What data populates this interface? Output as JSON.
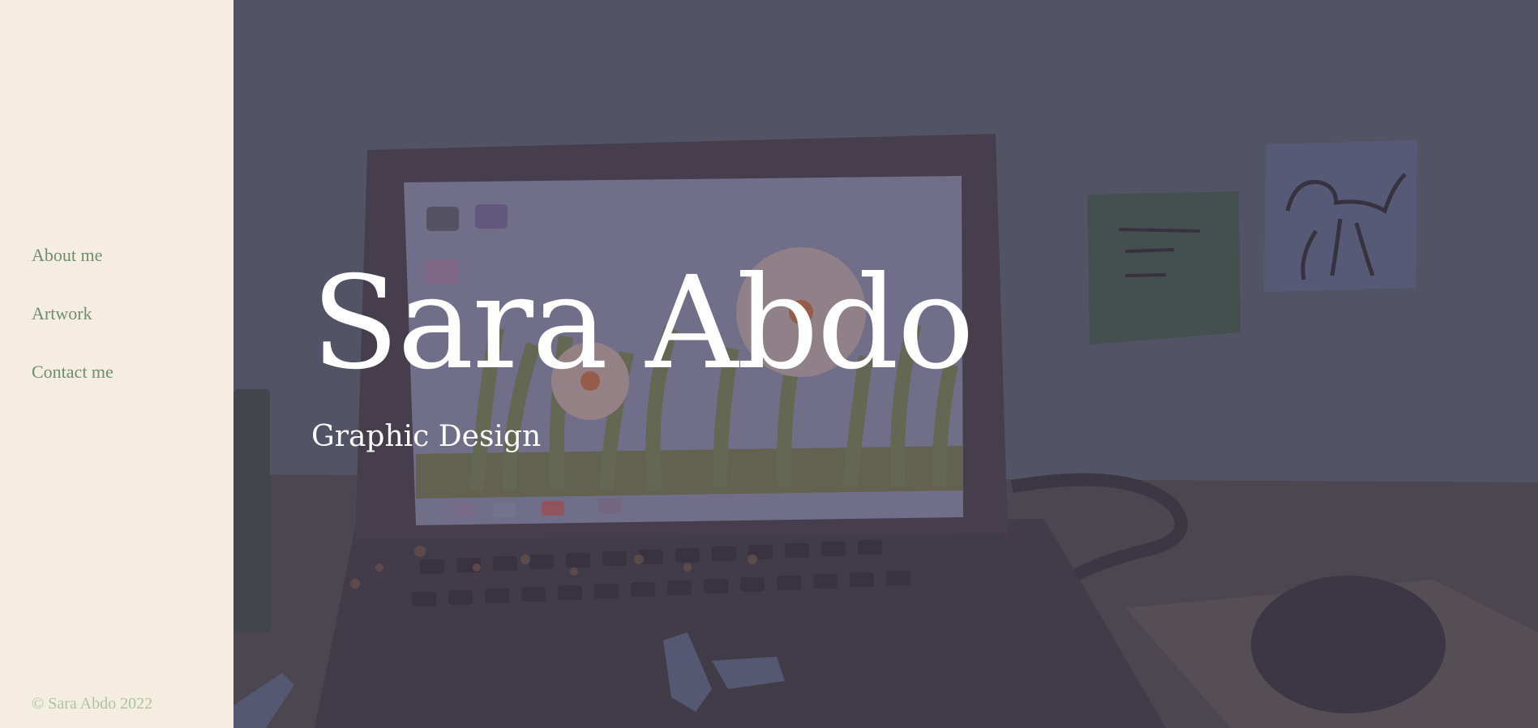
{
  "sidebar": {
    "nav": [
      {
        "label": "About me"
      },
      {
        "label": "Artwork"
      },
      {
        "label": "Contact me"
      }
    ],
    "copyright": "© Sara Abdo 2022"
  },
  "hero": {
    "title": "Sara Abdo",
    "subtitle": "Graphic Design",
    "background_illustration": "laptop-on-desk-illustration"
  },
  "colors": {
    "sidebar_bg": "#f5eddf",
    "nav_text": "#6f8e6e",
    "copyright_text": "#a9c5a3",
    "hero_overlay": "#5a5c6e",
    "hero_text": "#ffffff"
  }
}
